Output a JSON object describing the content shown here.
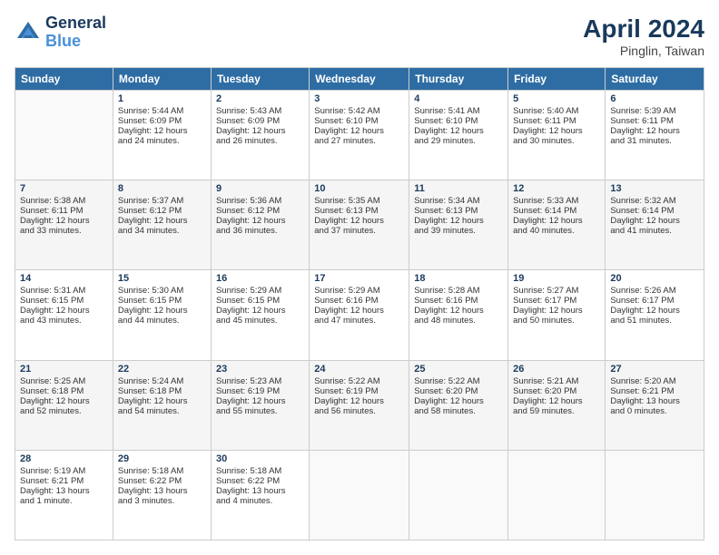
{
  "header": {
    "logo_line1": "General",
    "logo_line2": "Blue",
    "month": "April 2024",
    "location": "Pinglin, Taiwan"
  },
  "columns": [
    "Sunday",
    "Monday",
    "Tuesday",
    "Wednesday",
    "Thursday",
    "Friday",
    "Saturday"
  ],
  "weeks": [
    [
      {
        "day": "",
        "text": ""
      },
      {
        "day": "1",
        "text": "Sunrise: 5:44 AM\nSunset: 6:09 PM\nDaylight: 12 hours\nand 24 minutes."
      },
      {
        "day": "2",
        "text": "Sunrise: 5:43 AM\nSunset: 6:09 PM\nDaylight: 12 hours\nand 26 minutes."
      },
      {
        "day": "3",
        "text": "Sunrise: 5:42 AM\nSunset: 6:10 PM\nDaylight: 12 hours\nand 27 minutes."
      },
      {
        "day": "4",
        "text": "Sunrise: 5:41 AM\nSunset: 6:10 PM\nDaylight: 12 hours\nand 29 minutes."
      },
      {
        "day": "5",
        "text": "Sunrise: 5:40 AM\nSunset: 6:11 PM\nDaylight: 12 hours\nand 30 minutes."
      },
      {
        "day": "6",
        "text": "Sunrise: 5:39 AM\nSunset: 6:11 PM\nDaylight: 12 hours\nand 31 minutes."
      }
    ],
    [
      {
        "day": "7",
        "text": "Sunrise: 5:38 AM\nSunset: 6:11 PM\nDaylight: 12 hours\nand 33 minutes."
      },
      {
        "day": "8",
        "text": "Sunrise: 5:37 AM\nSunset: 6:12 PM\nDaylight: 12 hours\nand 34 minutes."
      },
      {
        "day": "9",
        "text": "Sunrise: 5:36 AM\nSunset: 6:12 PM\nDaylight: 12 hours\nand 36 minutes."
      },
      {
        "day": "10",
        "text": "Sunrise: 5:35 AM\nSunset: 6:13 PM\nDaylight: 12 hours\nand 37 minutes."
      },
      {
        "day": "11",
        "text": "Sunrise: 5:34 AM\nSunset: 6:13 PM\nDaylight: 12 hours\nand 39 minutes."
      },
      {
        "day": "12",
        "text": "Sunrise: 5:33 AM\nSunset: 6:14 PM\nDaylight: 12 hours\nand 40 minutes."
      },
      {
        "day": "13",
        "text": "Sunrise: 5:32 AM\nSunset: 6:14 PM\nDaylight: 12 hours\nand 41 minutes."
      }
    ],
    [
      {
        "day": "14",
        "text": "Sunrise: 5:31 AM\nSunset: 6:15 PM\nDaylight: 12 hours\nand 43 minutes."
      },
      {
        "day": "15",
        "text": "Sunrise: 5:30 AM\nSunset: 6:15 PM\nDaylight: 12 hours\nand 44 minutes."
      },
      {
        "day": "16",
        "text": "Sunrise: 5:29 AM\nSunset: 6:15 PM\nDaylight: 12 hours\nand 45 minutes."
      },
      {
        "day": "17",
        "text": "Sunrise: 5:29 AM\nSunset: 6:16 PM\nDaylight: 12 hours\nand 47 minutes."
      },
      {
        "day": "18",
        "text": "Sunrise: 5:28 AM\nSunset: 6:16 PM\nDaylight: 12 hours\nand 48 minutes."
      },
      {
        "day": "19",
        "text": "Sunrise: 5:27 AM\nSunset: 6:17 PM\nDaylight: 12 hours\nand 50 minutes."
      },
      {
        "day": "20",
        "text": "Sunrise: 5:26 AM\nSunset: 6:17 PM\nDaylight: 12 hours\nand 51 minutes."
      }
    ],
    [
      {
        "day": "21",
        "text": "Sunrise: 5:25 AM\nSunset: 6:18 PM\nDaylight: 12 hours\nand 52 minutes."
      },
      {
        "day": "22",
        "text": "Sunrise: 5:24 AM\nSunset: 6:18 PM\nDaylight: 12 hours\nand 54 minutes."
      },
      {
        "day": "23",
        "text": "Sunrise: 5:23 AM\nSunset: 6:19 PM\nDaylight: 12 hours\nand 55 minutes."
      },
      {
        "day": "24",
        "text": "Sunrise: 5:22 AM\nSunset: 6:19 PM\nDaylight: 12 hours\nand 56 minutes."
      },
      {
        "day": "25",
        "text": "Sunrise: 5:22 AM\nSunset: 6:20 PM\nDaylight: 12 hours\nand 58 minutes."
      },
      {
        "day": "26",
        "text": "Sunrise: 5:21 AM\nSunset: 6:20 PM\nDaylight: 12 hours\nand 59 minutes."
      },
      {
        "day": "27",
        "text": "Sunrise: 5:20 AM\nSunset: 6:21 PM\nDaylight: 13 hours\nand 0 minutes."
      }
    ],
    [
      {
        "day": "28",
        "text": "Sunrise: 5:19 AM\nSunset: 6:21 PM\nDaylight: 13 hours\nand 1 minute."
      },
      {
        "day": "29",
        "text": "Sunrise: 5:18 AM\nSunset: 6:22 PM\nDaylight: 13 hours\nand 3 minutes."
      },
      {
        "day": "30",
        "text": "Sunrise: 5:18 AM\nSunset: 6:22 PM\nDaylight: 13 hours\nand 4 minutes."
      },
      {
        "day": "",
        "text": ""
      },
      {
        "day": "",
        "text": ""
      },
      {
        "day": "",
        "text": ""
      },
      {
        "day": "",
        "text": ""
      }
    ]
  ]
}
